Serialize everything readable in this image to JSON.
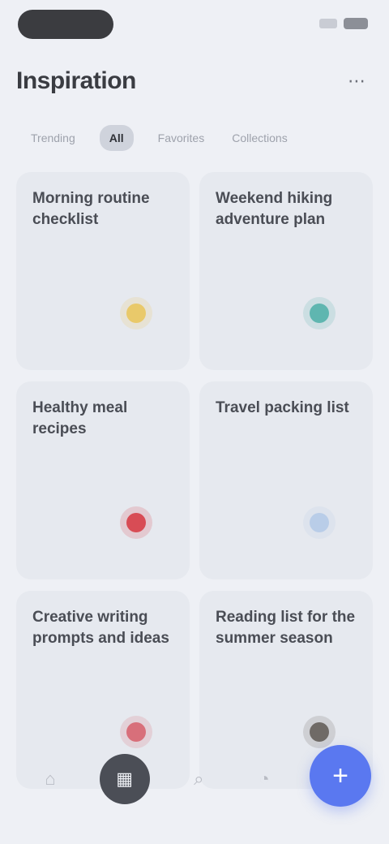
{
  "header": {
    "title": "Inspiration",
    "action_icon": "more-icon"
  },
  "tabs": [
    {
      "label": "Trending",
      "active": false
    },
    {
      "label": "All",
      "active": true
    },
    {
      "label": "Favorites",
      "active": false
    },
    {
      "label": "Collections",
      "active": false
    }
  ],
  "cards": [
    {
      "title": "Morning routine checklist",
      "icon": "sun-icon",
      "color": "#e9c96a"
    },
    {
      "title": "Weekend hiking adventure plan",
      "icon": "leaf-icon",
      "color": "#5fb6b0"
    },
    {
      "title": "Healthy meal recipes",
      "icon": "heart-icon",
      "color": "#d84c55"
    },
    {
      "title": "Travel packing list",
      "icon": "plane-icon",
      "color": "#b9cde8"
    },
    {
      "title": "Creative writing prompts and ideas",
      "icon": "pen-icon",
      "color": "#d86f7a"
    },
    {
      "title": "Reading list for the summer season",
      "icon": "book-icon",
      "color": "#6f6a66"
    }
  ],
  "nav": {
    "items": [
      {
        "icon": "home-icon",
        "active": false
      },
      {
        "icon": "grid-icon",
        "active": true
      },
      {
        "icon": "search-icon",
        "active": false
      },
      {
        "icon": "profile-icon",
        "active": false
      }
    ],
    "fab_icon": "plus-icon",
    "fab_symbol": "+"
  }
}
